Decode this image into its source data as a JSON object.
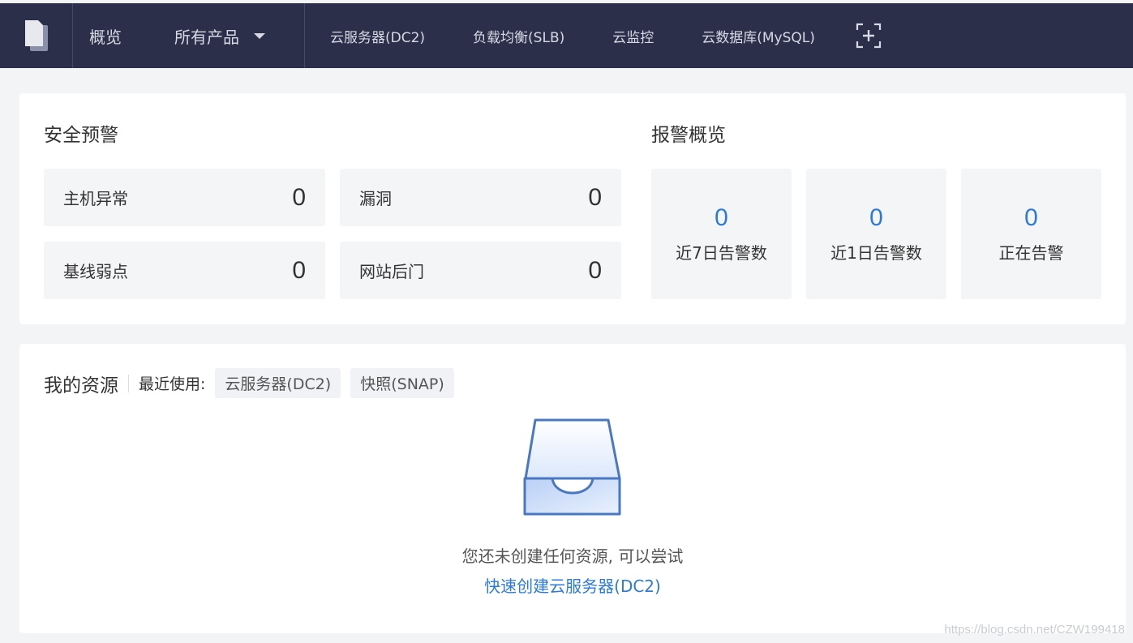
{
  "topnav": {
    "overview": "概览",
    "all_products": "所有产品",
    "products": [
      "云服务器(DC2)",
      "负载均衡(SLB)",
      "云监控",
      "云数据库(MySQL)"
    ],
    "logo_icon": "document-icon",
    "add_icon": "add-shortcut-icon"
  },
  "security": {
    "title": "安全预警",
    "items": [
      {
        "label": "主机异常",
        "value": "0"
      },
      {
        "label": "漏洞",
        "value": "0"
      },
      {
        "label": "基线弱点",
        "value": "0"
      },
      {
        "label": "网站后门",
        "value": "0"
      }
    ]
  },
  "alerts": {
    "title": "报警概览",
    "items": [
      {
        "value": "0",
        "label": "近7日告警数"
      },
      {
        "value": "0",
        "label": "近1日告警数"
      },
      {
        "value": "0",
        "label": "正在告警"
      }
    ]
  },
  "resources": {
    "title": "我的资源",
    "recent_label": "最近使用:",
    "recent_tags": [
      "云服务器(DC2)",
      "快照(SNAP)"
    ],
    "empty_text": "您还未创建任何资源, 可以尝试",
    "empty_link": "快速创建云服务器(DC2)"
  },
  "watermark": "https://blog.csdn.net/CZW199418",
  "colors": {
    "nav_bg": "#2b2f4a",
    "accent": "#2e7ad8",
    "page_bg": "#f3f4f6"
  }
}
